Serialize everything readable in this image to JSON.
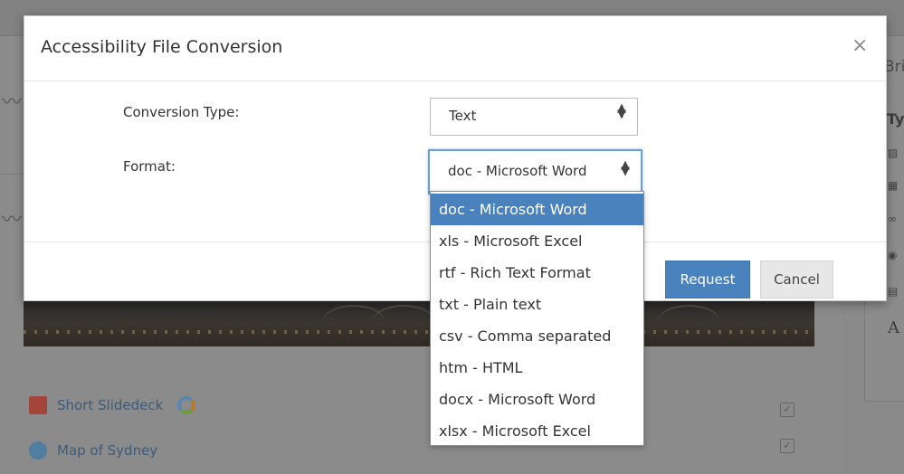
{
  "modal": {
    "title": "Accessibility File Conversion",
    "close_glyph": "×",
    "conversion_type_label": "Conversion Type:",
    "conversion_type_value": "Text",
    "format_label": "Format:",
    "format_value": "doc - Microsoft Word",
    "request_label": "Request",
    "cancel_label": "Cancel"
  },
  "format_options": [
    "doc - Microsoft Word",
    "xls - Microsoft Excel",
    "rtf - Rich Text Format",
    "txt - Plain text",
    "csv - Comma separated",
    "htm - HTML",
    "docx - Microsoft Word",
    "xlsx - Microsoft Excel"
  ],
  "background": {
    "files": [
      {
        "label": "Short Slidedeck",
        "icon": "pdf-icon"
      },
      {
        "label": "Map of Sydney",
        "icon": "globe-icon"
      }
    ],
    "right_panel_text": "Bri",
    "right_panel_heading": "Ty",
    "right_panel_letter": "A"
  },
  "colors": {
    "primary": "#4a82bd",
    "overlay": "#8a8a8a",
    "focus_border": "#6a9fd0"
  }
}
